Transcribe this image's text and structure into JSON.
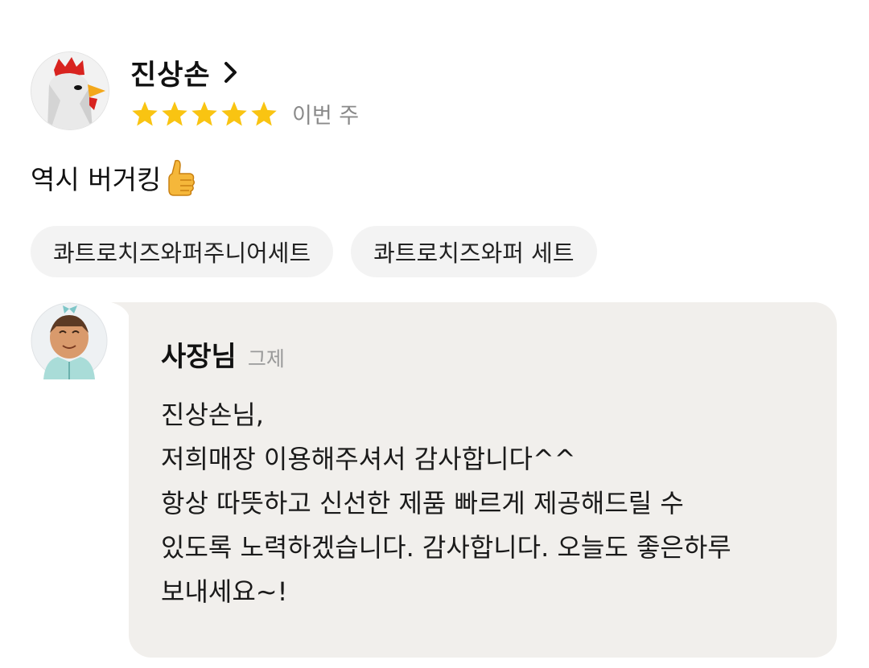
{
  "review": {
    "nickname": "진상손",
    "rating": 5,
    "rating_max": 5,
    "date": "이번 주",
    "text": "역시 버거킹",
    "text_emoji": "thumbs-up-icon",
    "star_color": "#f9c412",
    "menu_tags": [
      "콰트로치즈와퍼주니어세트",
      "콰트로치즈와퍼 세트"
    ]
  },
  "owner_reply": {
    "name": "사장님",
    "date": "그제",
    "lines": [
      "진상손님,",
      "저희매장 이용해주셔서 감사합니다^^",
      "항상 따뜻하고 신선한 제품 빠르게 제공해드릴 수",
      "있도록 노력하겠습니다. 감사합니다. 오늘도 좋은하루",
      "보내세요~!"
    ]
  }
}
